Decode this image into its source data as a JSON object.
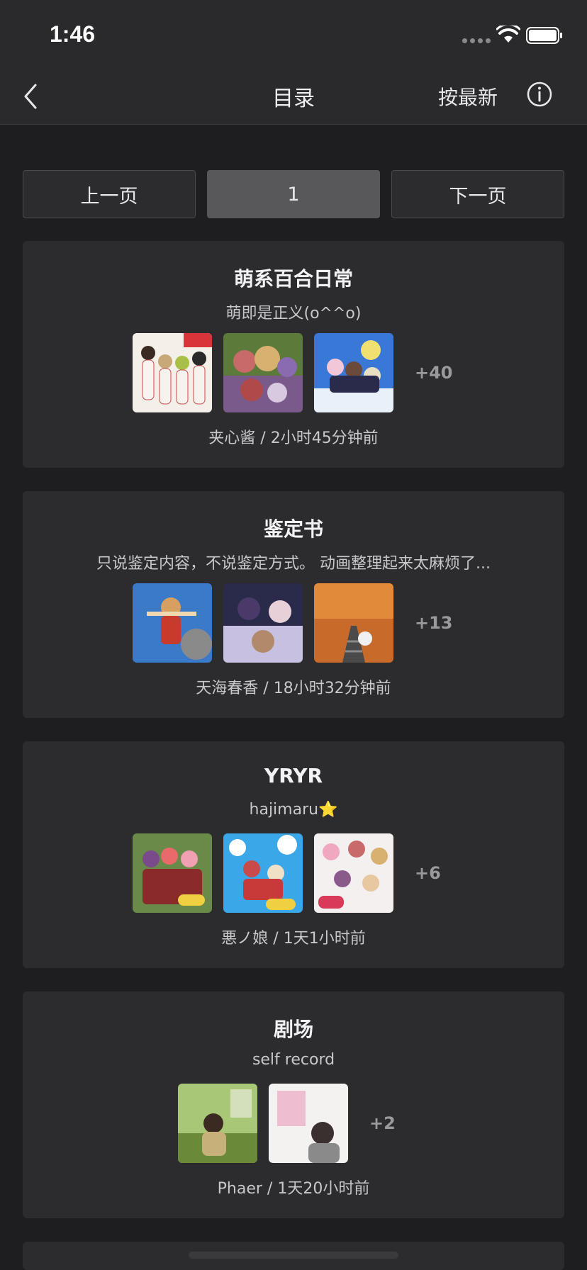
{
  "status": {
    "time": "1:46"
  },
  "nav": {
    "title": "目录",
    "sort_label": "按最新"
  },
  "pager": {
    "prev": "上一页",
    "current": "1",
    "next": "下一页"
  },
  "cards": [
    {
      "title": "萌系百合日常",
      "desc": "萌即是正义(o^^o)",
      "more": "+40",
      "author": "夹心酱",
      "time": "2小时45分钟前",
      "meta": "夹心酱 / 2小时45分钟前"
    },
    {
      "title": "鉴定书",
      "desc": "只说鉴定内容，不说鉴定方式。 动画整理起来太麻烦了...",
      "more": "+13",
      "author": "天海春香",
      "time": "18小时32分钟前",
      "meta": "天海春香 / 18小时32分钟前"
    },
    {
      "title": "YRYR",
      "desc": "hajimaru⭐",
      "more": "+6",
      "author": "悪ノ娘",
      "time": "1天1小时前",
      "meta": "悪ノ娘 / 1天1小时前"
    },
    {
      "title": "剧场",
      "desc": "self record",
      "more": "+2",
      "author": "Phaer",
      "time": "1天20小时前",
      "meta": "Phaer / 1天20小时前"
    }
  ]
}
